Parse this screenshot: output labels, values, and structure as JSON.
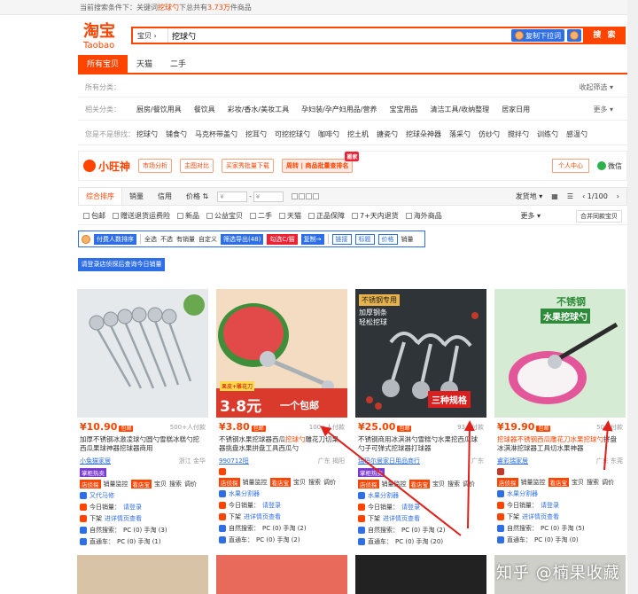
{
  "topbar": {
    "prefix": "当前搜索条件下：关键词",
    "keyword": "挖球勺",
    "mid": "下总共有",
    "count": "3.73万",
    "suffix": "件商品"
  },
  "logo": {
    "cn": "淘宝",
    "en": "Taobao"
  },
  "search": {
    "category": "宝贝",
    "value": "挖球勺",
    "img_btn": "复制下拉词",
    "button": "搜 索"
  },
  "tabs": [
    "所有宝贝",
    "天猫",
    "二手"
  ],
  "categories": {
    "label": "所有分类：",
    "right": "收起筛选"
  },
  "related": {
    "label": "相关分类：",
    "items": [
      "厨房/餐饮用具",
      "餐饮具",
      "彩妆/香水/美妆工具",
      "孕妇装/孕产妇用品/营养",
      "宝宝用品",
      "清洁工具/收纳整理",
      "居家日用"
    ],
    "more": "更多"
  },
  "want": {
    "label": "您是不是想找：",
    "items": [
      "挖球勺",
      "铺食勺",
      "马克杯带盖勺",
      "挖耳勺",
      "可挖挖球勺",
      "咖啡勺",
      "挖土机",
      "搪瓷勺",
      "挖球朵神器",
      "落采勺",
      "仿纱勺",
      "搅拌勺",
      "训练勺",
      "感温勺"
    ]
  },
  "zhuanshen": {
    "logo": "小旺神",
    "buttons": [
      "市场分析",
      "主图对比",
      "买家秀批量下载",
      "周转 | 商品批量查排名"
    ],
    "tag": "搬家",
    "user": "个人中心",
    "wechat": "微信"
  },
  "sort": {
    "items": [
      "综合排序",
      "销量",
      "信用",
      "价格"
    ],
    "currency1": "¥",
    "currency2": "¥",
    "ship": "发货地",
    "page": "1/100"
  },
  "filters": {
    "items": [
      "包邮",
      "赠送退货运费险",
      "新品",
      "公益宝贝",
      "二手",
      "天猫",
      "正品保障",
      "7+天内退货",
      "海外商品"
    ],
    "more": "更多",
    "merge": "合并同款宝贝"
  },
  "toolbar": {
    "items": [
      {
        "t": "付费人数排序",
        "k": "bl"
      },
      {
        "t": "全选",
        "k": "a"
      },
      {
        "t": "不选",
        "k": "a"
      },
      {
        "t": "有销量",
        "k": "a"
      },
      {
        "t": "自定义",
        "k": "a"
      },
      {
        "t": "筛选导出(48)",
        "k": "bl"
      },
      {
        "t": "勾选C/猫",
        "k": "rd"
      },
      {
        "t": "复制→",
        "k": "bl"
      },
      {
        "t": "链接",
        "k": "bo"
      },
      {
        "t": "标题",
        "k": "bo"
      },
      {
        "t": "价格",
        "k": "bo"
      },
      {
        "t": "销量",
        "k": "a"
      }
    ]
  },
  "login_btn": "请登录店侦探后查询今日销量",
  "products": [
    {
      "price": "¥10.90",
      "badge": "包邮",
      "deals": "500+人付款",
      "title": "加厚不锈钢冰激凌球勺圆勺雪糕冰糕勺挖",
      "title2": "西瓜果球神器挖球器商用",
      "shop": "小兔猫家居",
      "loc": "浙江 金华",
      "tag1": "掌柜热卖",
      "tag2": "店侦探",
      "tag3": "销量监控",
      "tag4": "看店宝",
      "tag5": "宝贝",
      "tag6": "搜索",
      "tag7": "调价",
      "dl": "又代马修",
      "today": "今日销量：",
      "today_v": "请登录",
      "offline": "下架",
      "offline_t": "进详情页查看",
      "nat": "自然搜索：",
      "nat_v": "PC (0) 手淘 (3)",
      "car": "直通车：",
      "car_v": "PC (0) 手淘 (1)"
    },
    {
      "price": "¥3.80",
      "badge": "包邮",
      "deals": "100+人付款",
      "title": "不锈钢水果挖球器西瓜",
      "hl": "挖球勺",
      "title2": "雕花刀切果器挑盘水果拼盘工具西瓜勺",
      "shop": "990712阳",
      "loc": "广东 揭阳",
      "tag1": "",
      "tag2": "店侦探",
      "tag3": "销量监控",
      "tag4": "看店宝",
      "tag5": "宝贝",
      "tag6": "搜索",
      "tag7": "调价",
      "dl": "水果分割器",
      "today": "今日销量：",
      "today_v": "请登录",
      "offline": "下架",
      "offline_t": "进详情页查看",
      "nat": "自然搜索：",
      "nat_v": "PC (0) 手淘 (2)",
      "car": "直通车：",
      "car_v": "PC (0) 手淘 (2)"
    },
    {
      "price": "¥25.00",
      "badge": "包邮",
      "deals": "93人付款",
      "title": "不锈钢商用冰淇淋勺雪糕勺水果挖西瓜球",
      "title2": "勺子可弹式挖球器打球器",
      "shop": "瑞玛尔居家日用品商行",
      "loc": "广东",
      "tag1": "掌柜热卖",
      "tag2": "店侦探",
      "tag3": "销量监控",
      "tag4": "看店宝",
      "tag5": "宝贝",
      "tag6": "搜索",
      "tag7": "调价",
      "dl": "水果分割器",
      "today": "今日销量：",
      "today_v": "请登录",
      "offline": "下架",
      "offline_t": "进详情页查看",
      "nat": "自然搜索：",
      "nat_v": "PC (0) 手淘 (2)",
      "car": "直通车：",
      "car_v": "PC (0) 手淘 (20)"
    },
    {
      "price": "¥19.90",
      "badge": "包邮",
      "deals": "50人付款",
      "title": "挖球器不锈钢西瓜雕花刀水果",
      "hl": "挖球勺",
      "title2": "拼盘冰淇淋挖球器工具切水果神器",
      "shop": "睿彩瑞家居",
      "loc": "广东 东莞",
      "tag1": "",
      "tag2": "店侦探",
      "tag3": "销量监控",
      "tag4": "看店宝",
      "tag5": "宝贝",
      "tag6": "搜索",
      "tag7": "调价",
      "dl": "水果分割器",
      "today": "今日销量：",
      "today_v": "请登录",
      "offline": "下架",
      "offline_t": "进详情页查看",
      "nat": "自然搜索：",
      "nat_v": "PC (0) 手淘 (5)",
      "car": "直通车：",
      "car_v": "PC (0) 手淘 (0)"
    }
  ],
  "img_text": {
    "p2a": "果皮+雕花刀",
    "p2b": "3.8元",
    "p2c": "一个包邮",
    "p3a": "不锈钢专用",
    "p3b": "加厚钢条",
    "p3c": "轻松挖球",
    "p3d": "三种规格",
    "p4a": "不锈钢",
    "p4b": "水果挖球勺"
  },
  "watermark": "知乎 @楠果收藏",
  "colors": {
    "accent": "#ff4400",
    "blue": "#2e6ee6"
  }
}
